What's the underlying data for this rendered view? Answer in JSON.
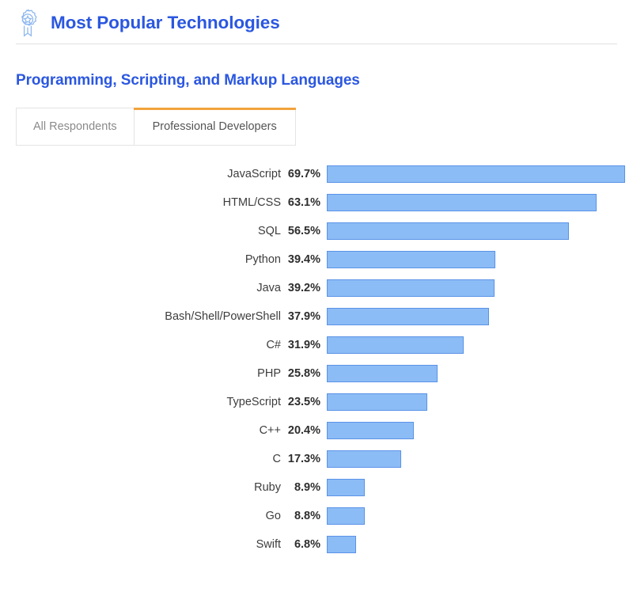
{
  "header": {
    "icon": "award-badge-icon",
    "title": "Most Popular Technologies"
  },
  "section": {
    "title": "Programming, Scripting, and Markup Languages"
  },
  "tabs": [
    {
      "label": "All Respondents",
      "active": false
    },
    {
      "label": "Professional Developers",
      "active": true
    }
  ],
  "colors": {
    "title_blue": "#2b57e0",
    "bar_fill": "#8cbcf5",
    "bar_border": "#5b93e8",
    "active_tab_accent": "#f2a33c",
    "label_text": "#3d3d3d",
    "inactive_tab_text": "#8a8a8a"
  },
  "chart_data": {
    "type": "bar",
    "title": "Programming, Scripting, and Markup Languages",
    "subtitle": "Professional Developers",
    "orientation": "horizontal",
    "xlabel": "",
    "ylabel": "",
    "xlim": [
      0,
      75
    ],
    "grid": false,
    "legend": null,
    "value_suffix": "%",
    "categories": [
      "JavaScript",
      "HTML/CSS",
      "SQL",
      "Python",
      "Java",
      "Bash/Shell/PowerShell",
      "C#",
      "PHP",
      "TypeScript",
      "C++",
      "C",
      "Ruby",
      "Go",
      "Swift"
    ],
    "values": [
      69.7,
      63.1,
      56.5,
      39.4,
      39.2,
      37.9,
      31.9,
      25.8,
      23.5,
      20.4,
      17.3,
      8.9,
      8.8,
      6.8
    ],
    "labels": [
      "69.7%",
      "63.1%",
      "56.5%",
      "39.4%",
      "39.2%",
      "37.9%",
      "31.9%",
      "25.8%",
      "23.5%",
      "20.4%",
      "17.3%",
      "8.9%",
      "8.8%",
      "6.8%"
    ],
    "rows": [
      {
        "label": "JavaScript",
        "value": 69.7,
        "display": "69.7%"
      },
      {
        "label": "HTML/CSS",
        "value": 63.1,
        "display": "63.1%"
      },
      {
        "label": "SQL",
        "value": 56.5,
        "display": "56.5%"
      },
      {
        "label": "Python",
        "value": 39.4,
        "display": "39.4%"
      },
      {
        "label": "Java",
        "value": 39.2,
        "display": "39.2%"
      },
      {
        "label": "Bash/Shell/PowerShell",
        "value": 37.9,
        "display": "37.9%"
      },
      {
        "label": "C#",
        "value": 31.9,
        "display": "31.9%"
      },
      {
        "label": "PHP",
        "value": 25.8,
        "display": "25.8%"
      },
      {
        "label": "TypeScript",
        "value": 23.5,
        "display": "23.5%"
      },
      {
        "label": "C++",
        "value": 20.4,
        "display": "20.4%"
      },
      {
        "label": "C",
        "value": 17.3,
        "display": "17.3%"
      },
      {
        "label": "Ruby",
        "value": 8.9,
        "display": "8.9%"
      },
      {
        "label": "Go",
        "value": 8.8,
        "display": "8.8%"
      },
      {
        "label": "Swift",
        "value": 6.8,
        "display": "6.8%"
      }
    ]
  }
}
